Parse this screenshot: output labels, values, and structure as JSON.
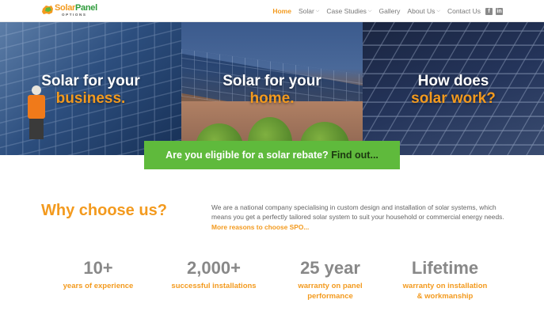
{
  "logo": {
    "name_part1": "Solar",
    "name_part2": "Panel",
    "sub": "OPTIONS"
  },
  "nav": {
    "items": [
      {
        "label": "Home",
        "active": true,
        "has_dropdown": false
      },
      {
        "label": "Solar",
        "active": false,
        "has_dropdown": true
      },
      {
        "label": "Case Studies",
        "active": false,
        "has_dropdown": true
      },
      {
        "label": "Gallery",
        "active": false,
        "has_dropdown": false
      },
      {
        "label": "About Us",
        "active": false,
        "has_dropdown": true
      },
      {
        "label": "Contact Us",
        "active": false,
        "has_dropdown": false
      }
    ],
    "social": [
      "facebook-icon",
      "linkedin-icon"
    ]
  },
  "hero": {
    "tiles": [
      {
        "line1": "Solar for your",
        "line2": "business."
      },
      {
        "line1": "Solar for your",
        "line2": "home."
      },
      {
        "line1": "How does",
        "line2": "solar work?"
      }
    ]
  },
  "cta": {
    "text": "Are you eligible for a solar rebate?",
    "link": "Find out..."
  },
  "why": {
    "title": "Why choose us?",
    "body": "We are a national company specialising in custom design and installation of solar systems, which means you get a perfectly tailored solar system to suit your household or commercial energy needs.",
    "more": "More reasons to choose SPO..."
  },
  "stats": [
    {
      "value": "10+",
      "label_line1": "years of experience",
      "label_line2": ""
    },
    {
      "value": "2,000+",
      "label_line1": "successful installations",
      "label_line2": ""
    },
    {
      "value": "25 year",
      "label_line1": "warranty on panel",
      "label_line2": "performance"
    },
    {
      "value": "Lifetime",
      "label_line1": "warranty on installation",
      "label_line2": "& workmanship"
    }
  ],
  "colors": {
    "accent": "#f39a1e",
    "green": "#5fba3c",
    "text_gray": "#666666"
  }
}
